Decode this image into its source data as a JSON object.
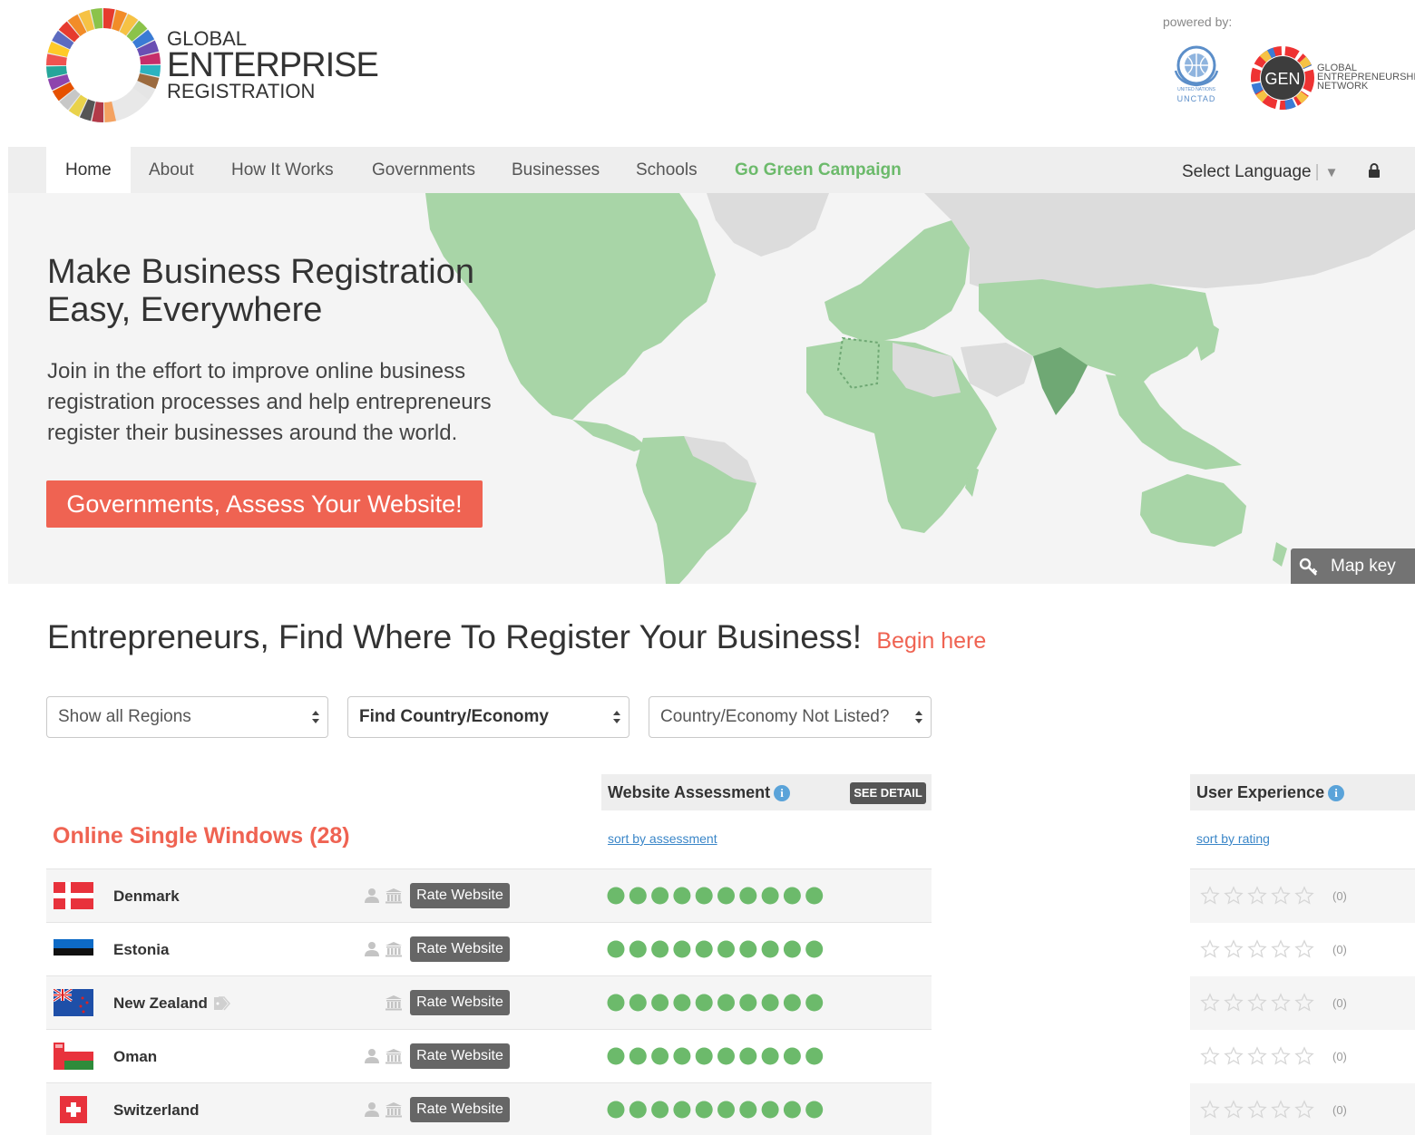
{
  "logo": {
    "line1": "GLOBAL",
    "line2": "ENTERPRISE",
    "line3": "REGISTRATION"
  },
  "powered": {
    "label": "powered by:",
    "unctad_small": "UNITED NATIONS",
    "unctad": "UNCTAD",
    "gen_badge": "GEN",
    "gen_line1": "GLOBAL",
    "gen_line2": "ENTREPRENEURSHIP",
    "gen_line3": "NETWORK"
  },
  "nav": {
    "items": [
      "Home",
      "About",
      "How It Works",
      "Governments",
      "Businesses",
      "Schools",
      "Go Green Campaign"
    ],
    "language": "Select Language",
    "lock_icon": "lock-icon"
  },
  "hero": {
    "title_line1": "Make Business Registration",
    "title_line2": "Easy, Everywhere",
    "text": "Join in the effort to improve online business registration processes and help entrepreneurs register their businesses around the world.",
    "cta": "Governments, Assess Your Website!",
    "map_key": "Map key"
  },
  "find": {
    "title": "Entrepreneurs, Find Where To Register Your Business!",
    "begin": "Begin here",
    "selects": [
      "Show all Regions",
      "Find Country/Economy",
      "Country/Economy Not Listed?"
    ]
  },
  "table": {
    "website_assessment": "Website Assessment",
    "see_detail": "SEE DETAIL",
    "user_experience": "User Experience",
    "section_title": "Online Single Windows (28)",
    "sort_assessment": "sort by assessment",
    "sort_rating": "sort by rating",
    "rate_label": "Rate Website",
    "rows": [
      {
        "country": "Denmark",
        "count": "(0)",
        "assessment_dots": 10,
        "rating": 0
      },
      {
        "country": "Estonia",
        "count": "(0)",
        "assessment_dots": 10,
        "rating": 0
      },
      {
        "country": "New Zealand",
        "count": "(0)",
        "assessment_dots": 10,
        "rating": 0
      },
      {
        "country": "Oman",
        "count": "(0)",
        "assessment_dots": 10,
        "rating": 0
      },
      {
        "country": "Switzerland",
        "count": "(0)",
        "assessment_dots": 10,
        "rating": 0
      }
    ]
  },
  "colors": {
    "accent": "#ef6352",
    "green": "#6cba6b",
    "map_green": "#a8d5a7",
    "map_dark": "#6fa874",
    "map_grey": "#dcdcdc"
  }
}
